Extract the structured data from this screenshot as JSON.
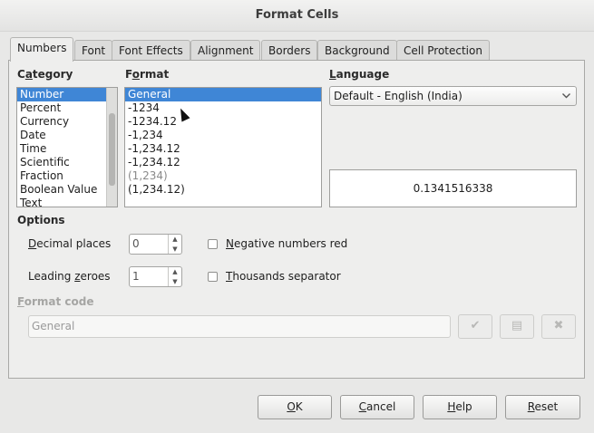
{
  "window": {
    "title": "Format Cells"
  },
  "tabs": [
    "Numbers",
    "Font",
    "Font Effects",
    "Alignment",
    "Borders",
    "Background",
    "Cell Protection"
  ],
  "category": {
    "label_pre": "C",
    "label_u": "a",
    "label_post": "tegory",
    "items": [
      "Number",
      "Percent",
      "Currency",
      "Date",
      "Time",
      "Scientific",
      "Fraction",
      "Boolean Value",
      "Text"
    ],
    "selected": "Number"
  },
  "format": {
    "label_pre": "F",
    "label_u": "o",
    "label_post": "rmat",
    "items": [
      "General",
      "-1234",
      "-1234.12",
      "-1,234",
      "-1,234.12",
      "-1,234.12",
      "(1,234)",
      "(1,234.12)"
    ],
    "selected": "General"
  },
  "language": {
    "label_pre": "",
    "label_u": "L",
    "label_post": "anguage",
    "value": "Default - English (India)"
  },
  "preview": {
    "value": "0.1341516338"
  },
  "options": {
    "label": "Options",
    "decimal_places": {
      "label_pre": "",
      "label_u": "D",
      "label_post": "ecimal places",
      "value": "0"
    },
    "leading_zeroes": {
      "label_pre": "Leading ",
      "label_u": "z",
      "label_post": "eroes",
      "value": "1"
    },
    "negative_red": {
      "label_pre": "",
      "label_u": "N",
      "label_post": "egative numbers red",
      "checked": false
    },
    "thousands_sep": {
      "label_pre": "",
      "label_u": "T",
      "label_post": "housands separator",
      "checked": false
    }
  },
  "format_code": {
    "label_pre": "",
    "label_u": "F",
    "label_post": "ormat code",
    "value": "General"
  },
  "buttons": {
    "ok": {
      "pre": "",
      "u": "O",
      "post": "K"
    },
    "cancel": {
      "pre": "",
      "u": "C",
      "post": "ancel"
    },
    "help": {
      "pre": "",
      "u": "H",
      "post": "elp"
    },
    "reset": {
      "pre": "",
      "u": "R",
      "post": "eset"
    }
  },
  "icons": [
    "check-icon",
    "comment-icon",
    "delete-icon"
  ]
}
